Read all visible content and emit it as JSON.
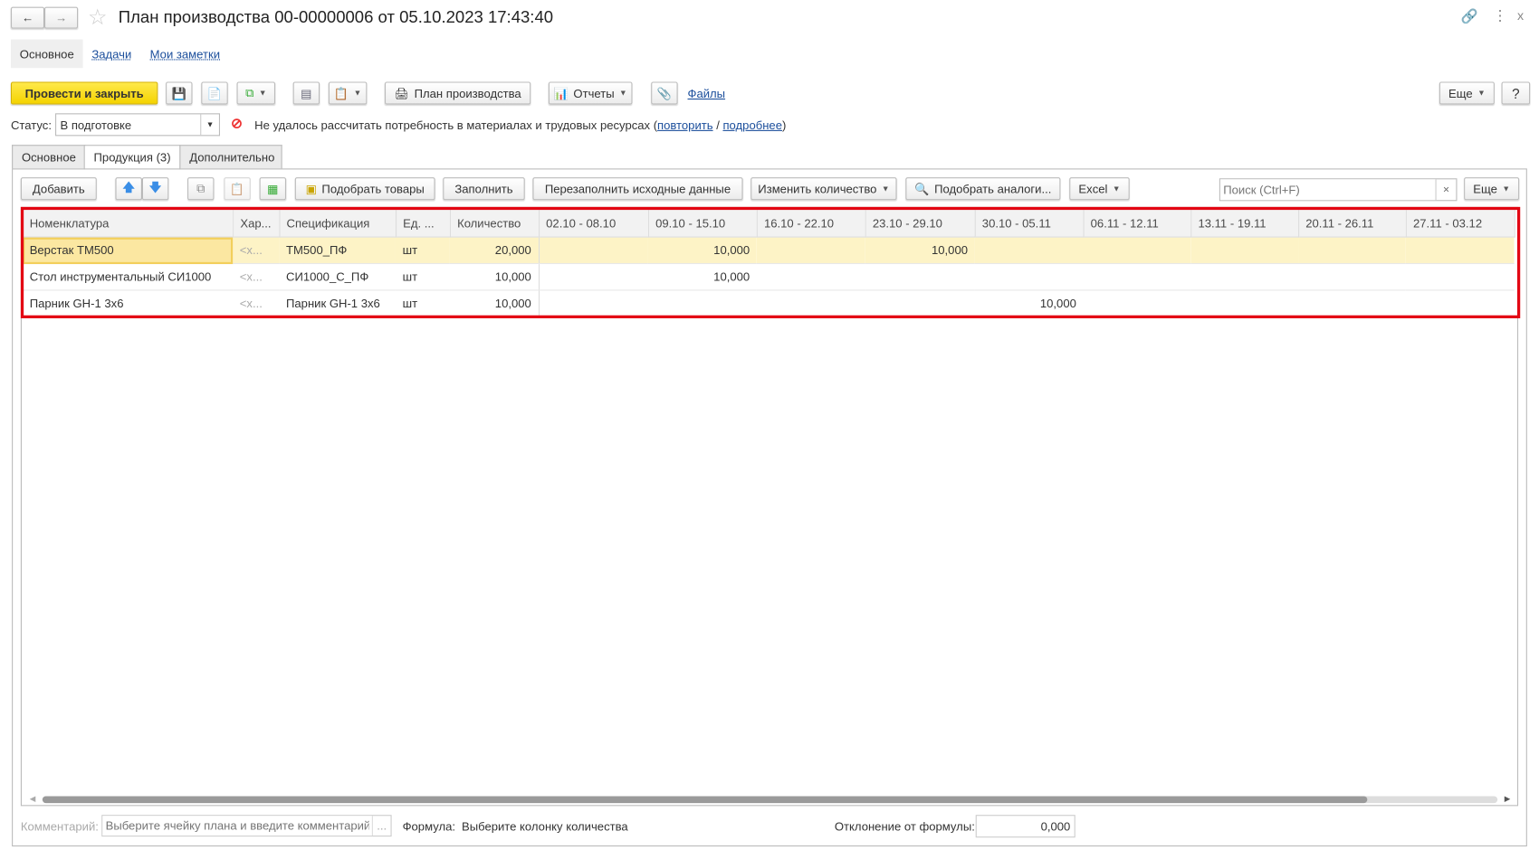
{
  "window": {
    "title": "План производства 00-00000006 от 05.10.2023 17:43:40"
  },
  "nav_tabs": [
    {
      "label": "Основное"
    },
    {
      "label": "Задачи"
    },
    {
      "label": "Мои заметки"
    }
  ],
  "toolbar": {
    "post_close": "Провести и закрыть",
    "print_plan": "План производства",
    "reports": "Отчеты",
    "files": "Файлы",
    "more": "Еще",
    "help": "?"
  },
  "status": {
    "label": "Статус:",
    "value": "В подготовке",
    "message": "Не удалось рассчитать потребность в материалах и трудовых ресурсах (",
    "retry": "повторить",
    "sep": " / ",
    "details": "подробнее",
    "close_paren": ")"
  },
  "form_tabs": [
    {
      "label": "Основное"
    },
    {
      "label": "Продукция (3)"
    },
    {
      "label": "Дополнительно"
    }
  ],
  "table_toolbar": {
    "add": "Добавить",
    "pick_goods": "Подобрать товары",
    "fill": "Заполнить",
    "refill": "Перезаполнить исходные данные",
    "change_qty": "Изменить количество",
    "pick_analogs": "Подобрать аналоги...",
    "excel": "Excel",
    "search_placeholder": "Поиск (Ctrl+F)",
    "clear": "×",
    "more": "Еще"
  },
  "table": {
    "columns": [
      "Номенклатура",
      "Хар...",
      "Спецификация",
      "Ед. ...",
      "Количество",
      "02.10 - 08.10",
      "09.10 - 15.10",
      "16.10 - 22.10",
      "23.10 - 29.10",
      "30.10 - 05.11",
      "06.11 - 12.11",
      "13.11 - 19.11",
      "20.11 - 26.11",
      "27.11 - 03.12"
    ],
    "rows": [
      [
        "Верстак ТМ500",
        "<х...",
        "ТМ500_ПФ",
        "шт",
        "20,000",
        "",
        "10,000",
        "",
        "10,000",
        "",
        "",
        "",
        "",
        ""
      ],
      [
        "Стол инструментальный СИ1000",
        "<х...",
        "СИ1000_С_ПФ",
        "шт",
        "10,000",
        "",
        "10,000",
        "",
        "",
        "",
        "",
        "",
        "",
        ""
      ],
      [
        "Парник GH-1 3х6",
        "<х...",
        "Парник GH-1 3х6",
        "шт",
        "10,000",
        "",
        "",
        "",
        "",
        "10,000",
        "",
        "",
        "",
        ""
      ]
    ]
  },
  "footer": {
    "comment_label": "Комментарий:",
    "comment_placeholder": "Выберите ячейку плана и введите комментарий",
    "ellipsis": "...",
    "formula_label": "Формула:",
    "formula_value": "Выберите колонку количества",
    "deviation_label": "Отклонение от формулы:",
    "deviation_value": "0,000"
  },
  "colors": {
    "accent_yellow": "#f4d300",
    "highlight_red": "#e30613",
    "selected_row": "#fdf3c6"
  }
}
